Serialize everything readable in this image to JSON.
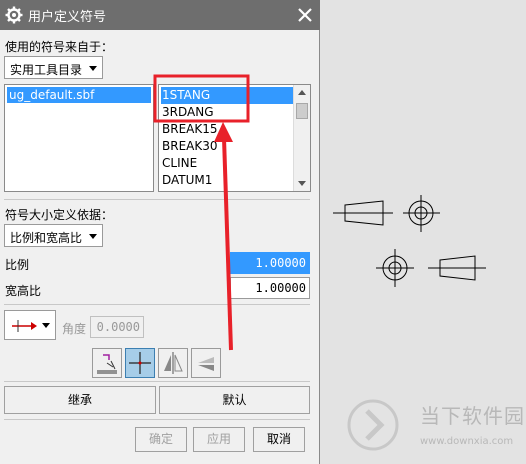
{
  "dialog": {
    "title": "用户定义符号",
    "source_label": "使用的符号来自于：",
    "source_value": "实用工具目录",
    "library_items": [
      "ug_default.sbf"
    ],
    "symbol_items": [
      "1STANG",
      "3RDANG",
      "BREAK15",
      "BREAK30",
      "CLINE",
      "DATUM1"
    ],
    "selected_symbol": "1STANG",
    "size_label": "符号大小定义依据：",
    "size_value": "比例和宽高比",
    "scale_label": "比例",
    "scale_value": "1.00000",
    "aspect_label": "宽高比",
    "aspect_value": "1.00000",
    "angle_label": "角度",
    "angle_value": "0.0000",
    "inherit_button": "继承",
    "default_button": "默认",
    "ok_button": "确定",
    "apply_button": "应用",
    "cancel_button": "取消"
  },
  "watermark": {
    "brand_text": "当下软件园",
    "url_text": "www.downxia.com"
  },
  "colors": {
    "selection": "#3399ff",
    "annotation_red": "#e8212a",
    "titlebar": "#6e6e6e"
  }
}
